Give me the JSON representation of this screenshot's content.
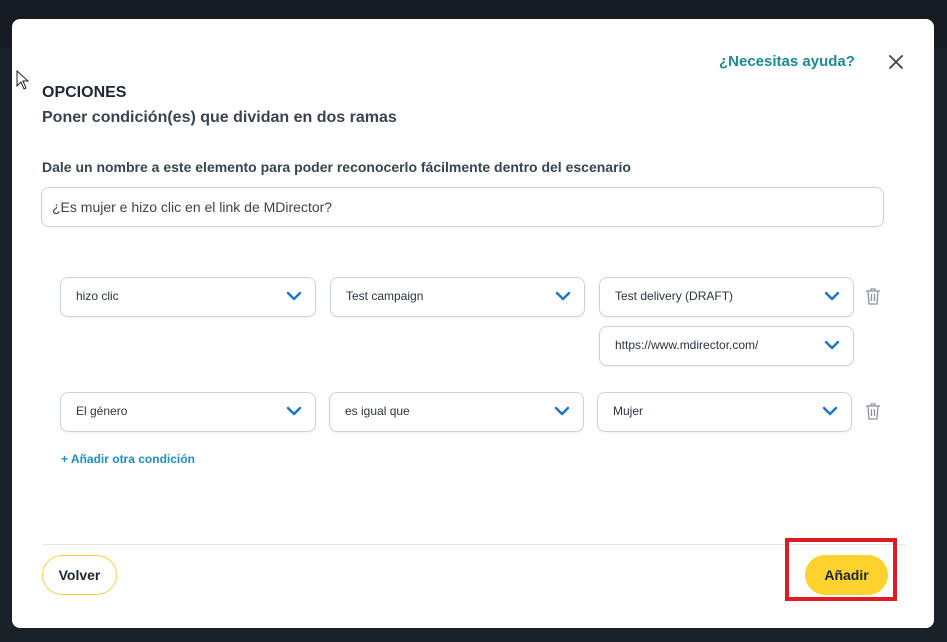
{
  "modal": {
    "help_link": "¿Necesitas ayuda?",
    "title": "OPCIONES",
    "subtitle": "Poner condición(es) que dividan en dos ramas",
    "name_label": "Dale un nombre a este elemento para poder reconocerlo fácilmente dentro del escenario",
    "name_value": "¿Es mujer e hizo clic en el link de MDirector?"
  },
  "conditions": [
    {
      "field": "hizo clic",
      "campaign": "Test campaign",
      "delivery": "Test delivery (DRAFT)",
      "link": "https://www.mdirector.com/"
    },
    {
      "field": "El género",
      "operator": "es igual que",
      "value": "Mujer"
    }
  ],
  "add_condition_label": "+ Añadir otra condición",
  "footer": {
    "back_label": "Volver",
    "add_label": "Añadir"
  },
  "icons": {
    "close": "close-icon",
    "chevron": "chevron-down-icon",
    "trash": "trash-icon",
    "cursor": "mouse-cursor-icon"
  },
  "colors": {
    "accent_teal": "#1a8a95",
    "link_blue": "#1b8fc9",
    "chevron_blue": "#1976c9",
    "primary_yellow": "#fdd22c",
    "highlight_red": "#e21b23"
  }
}
